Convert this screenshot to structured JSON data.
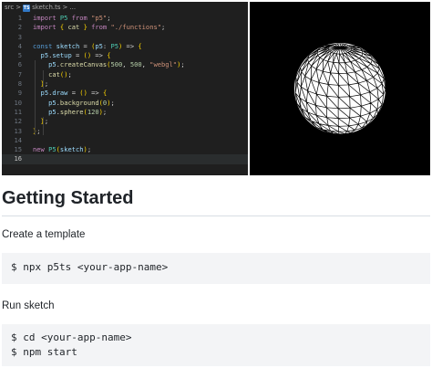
{
  "editor": {
    "breadcrumb": {
      "folder": "src",
      "sep1": ">",
      "file_badge": "TS",
      "file": "sketch.ts",
      "sep2": ">",
      "more": "..."
    },
    "line_numbers": [
      "1",
      "2",
      "3",
      "4",
      "5",
      "6",
      "7",
      "8",
      "9",
      "10",
      "11",
      "12",
      "13",
      "14",
      "15",
      "16"
    ],
    "code_lines": [
      "import P5 from \"p5\";",
      "import { cat } from \"./functions\";",
      "",
      "const sketch = (p5: P5) => {",
      "  p5.setup = () => {",
      "    p5.createCanvas(500, 500, \"webgl\");",
      "    cat();",
      "  };",
      "  p5.draw = () => {",
      "    p5.background(0);",
      "    p5.sphere(120);",
      "  };",
      "};",
      "",
      "new P5(sketch);",
      ""
    ]
  },
  "doc": {
    "heading": "Getting Started",
    "step1_label": "Create a template",
    "step1_code": [
      "$ npx p5ts <your-app-name>"
    ],
    "step2_label": "Run sketch",
    "step2_code": [
      "$ cd <your-app-name>",
      "$ npm start"
    ]
  }
}
